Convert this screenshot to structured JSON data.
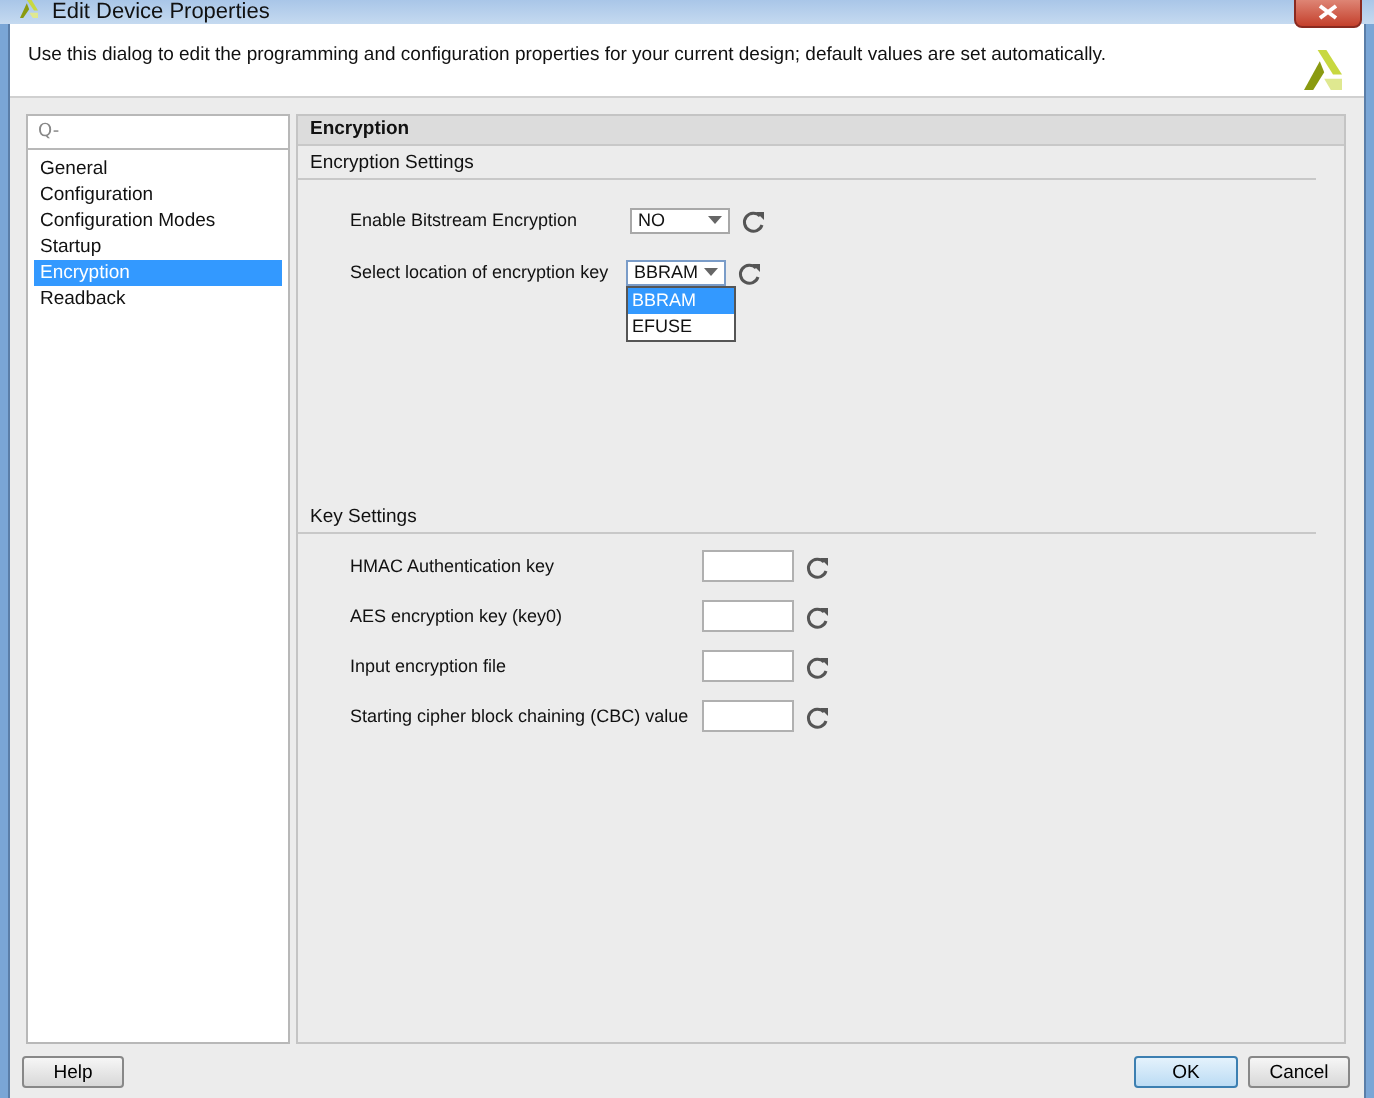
{
  "window": {
    "title": "Edit Device Properties"
  },
  "header": {
    "description": "Use this dialog to edit the programming and configuration properties for your current design; default values are set automatically."
  },
  "sidebar": {
    "search": {
      "placeholder": "Q-"
    },
    "items": [
      {
        "label": "General",
        "selected": false
      },
      {
        "label": "Configuration",
        "selected": false
      },
      {
        "label": "Configuration Modes",
        "selected": false
      },
      {
        "label": "Startup",
        "selected": false
      },
      {
        "label": "Encryption",
        "selected": true
      },
      {
        "label": "Readback",
        "selected": false
      }
    ]
  },
  "panel": {
    "title": "Encryption",
    "sections": [
      {
        "title": "Encryption Settings",
        "rows": [
          {
            "kind": "select",
            "label": "Enable Bitstream Encryption",
            "value": "NO",
            "expanded": false
          },
          {
            "kind": "select",
            "label": "Select location of encryption key",
            "value": "BBRAM",
            "expanded": true,
            "options": [
              {
                "label": "BBRAM",
                "selected": true
              },
              {
                "label": "EFUSE",
                "selected": false
              }
            ]
          }
        ]
      },
      {
        "title": "Key Settings",
        "rows": [
          {
            "kind": "text",
            "label": "HMAC Authentication key"
          },
          {
            "kind": "text",
            "label": "AES encryption key (key0)"
          },
          {
            "kind": "text",
            "label": "Input encryption file"
          },
          {
            "kind": "text",
            "label": "Starting cipher block chaining (CBC) value"
          }
        ]
      }
    ]
  },
  "buttons": [
    {
      "label": "Help",
      "kind": "left"
    },
    {
      "label": "OK",
      "kind": "default"
    },
    {
      "label": "Cancel",
      "kind": "normal"
    }
  ]
}
